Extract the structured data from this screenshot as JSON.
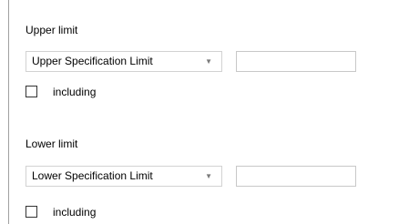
{
  "upper": {
    "label": "Upper limit",
    "dropdown_value": "Upper Specification Limit",
    "value": "",
    "including_label": "including",
    "including_checked": false
  },
  "lower": {
    "label": "Lower limit",
    "dropdown_value": "Lower Specification Limit",
    "value": "",
    "including_label": "including",
    "including_checked": false
  },
  "icons": {
    "dropdown_arrow": "chevron-down-icon"
  }
}
